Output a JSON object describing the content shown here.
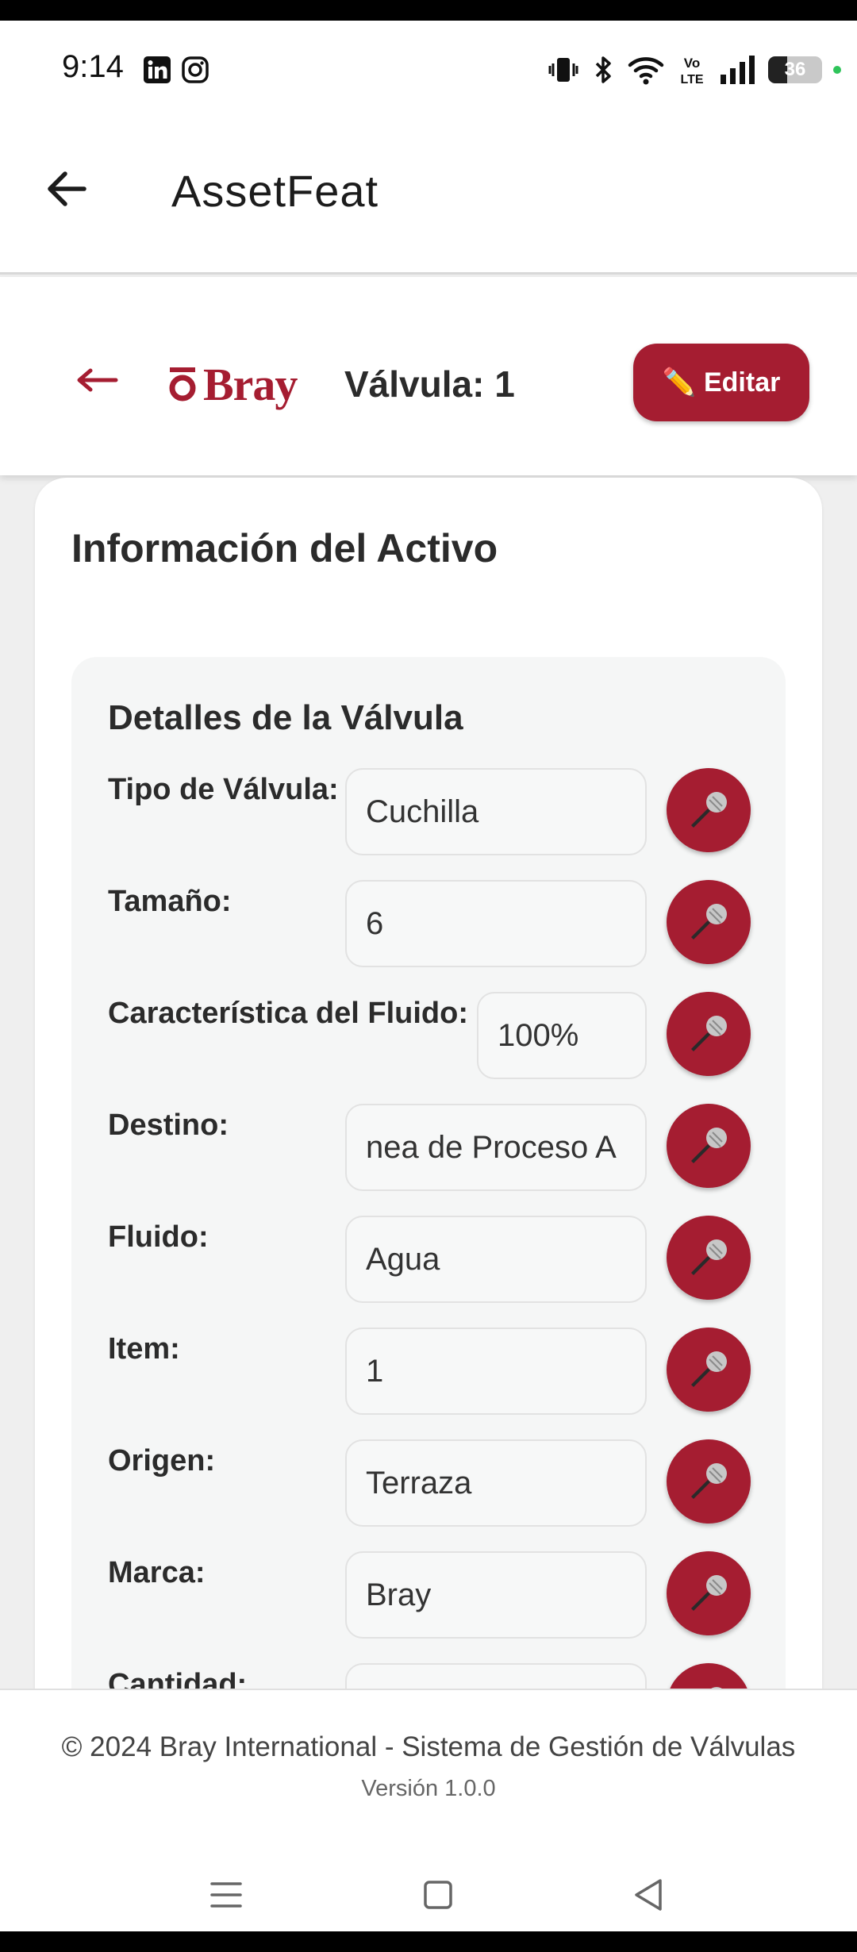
{
  "status_bar": {
    "time": "9:14",
    "apps": [
      "linkedin-icon",
      "instagram-icon"
    ],
    "battery": "36",
    "battery_level": 0.36
  },
  "app_bar": {
    "title": "AssetFeat"
  },
  "header": {
    "brand": "Bray",
    "valve_title": "Válvula: 1",
    "edit_label": "Editar",
    "edit_icon": "✏️"
  },
  "card": {
    "title": "Información del Activo",
    "section": {
      "title": "Detalles de la Válvula",
      "fields": [
        {
          "label": "Tipo de Válvula:",
          "value": "Cuchilla"
        },
        {
          "label": "Tamaño:",
          "value": "6"
        },
        {
          "label": "Característica del Fluido:",
          "value": "100%"
        },
        {
          "label": "Destino:",
          "value": "nea de Proceso A"
        },
        {
          "label": "Fluido:",
          "value": "Agua"
        },
        {
          "label": "Item:",
          "value": "1"
        },
        {
          "label": "Origen:",
          "value": "Terraza"
        },
        {
          "label": "Marca:",
          "value": "Bray"
        },
        {
          "label": "Cantidad:",
          "value": ""
        }
      ]
    }
  },
  "footer": {
    "copyright": "© 2024 Bray International - Sistema de Gestión de Válvulas",
    "version": "Versión 1.0.0"
  },
  "colors": {
    "brand": "#a51d31",
    "background": "#efefef"
  }
}
